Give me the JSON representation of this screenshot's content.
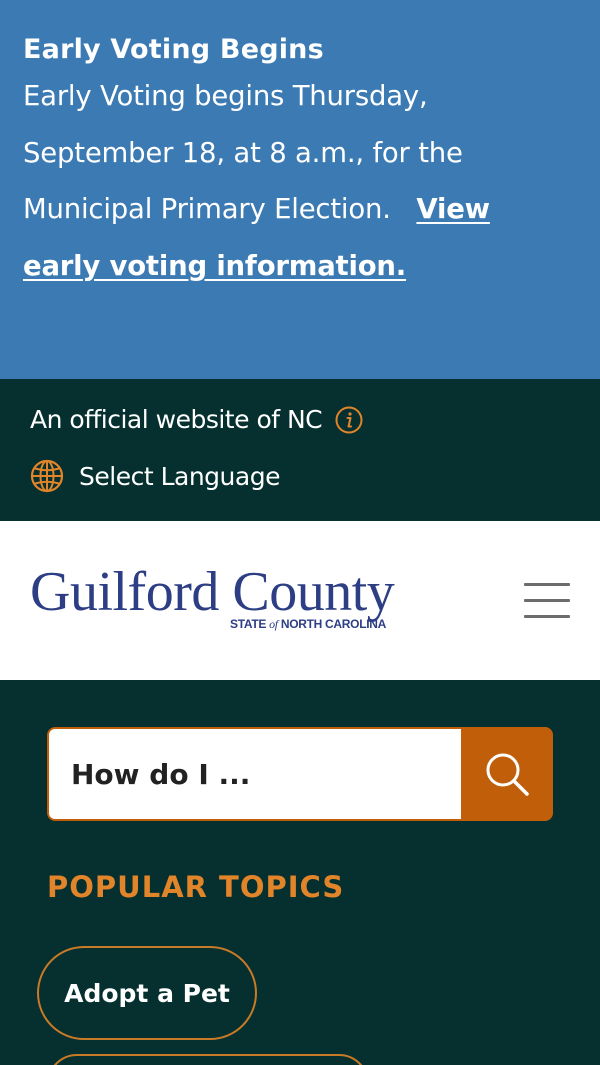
{
  "alert": {
    "title": "Early Voting Begins",
    "line1": "Early Voting begins Thursday,",
    "line2": "September 18, at 8 a.m., for the",
    "line3": "Municipal Primary Election.",
    "link_part1": "View",
    "link_part2": "early voting information."
  },
  "official_bar": {
    "text": "An official website of NC",
    "info_icon": "info-icon",
    "language_label": "Select Language",
    "language_icon": "globe-icon"
  },
  "header": {
    "logo_main": "Guilford County",
    "logo_sub_pre": "STATE ",
    "logo_sub_of": "of",
    "logo_sub_post": " NORTH CAROLINA",
    "menu_icon": "hamburger-menu-icon"
  },
  "search": {
    "placeholder": "How do I ...",
    "button_icon": "search-icon"
  },
  "popular_topics": {
    "heading": "POPULAR TOPICS",
    "items": [
      "Adopt a Pet"
    ]
  },
  "colors": {
    "alert_bg": "#3b7ab3",
    "dark_teal": "#05302f",
    "accent_orange": "#c15e0a",
    "heading_orange": "#e2842a",
    "logo_blue": "#2d3e84"
  }
}
